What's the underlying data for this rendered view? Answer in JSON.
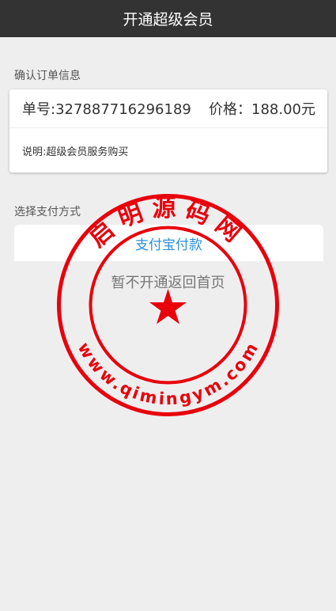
{
  "header": {
    "title": "开通超级会员"
  },
  "order": {
    "section_label": "确认订单信息",
    "number_text": "单号:327887716296189",
    "price_label": "价格：",
    "price_value": "188.00元",
    "description": "说明:超级会员服务购买"
  },
  "payment": {
    "section_label": "选择支付方式",
    "alipay_label": "支付宝付款",
    "back_label": "暂不开通返回首页"
  },
  "watermark": {
    "top_text": "启明源码网",
    "bottom_text": "www.qimingym.com",
    "color": "#e8000b"
  }
}
